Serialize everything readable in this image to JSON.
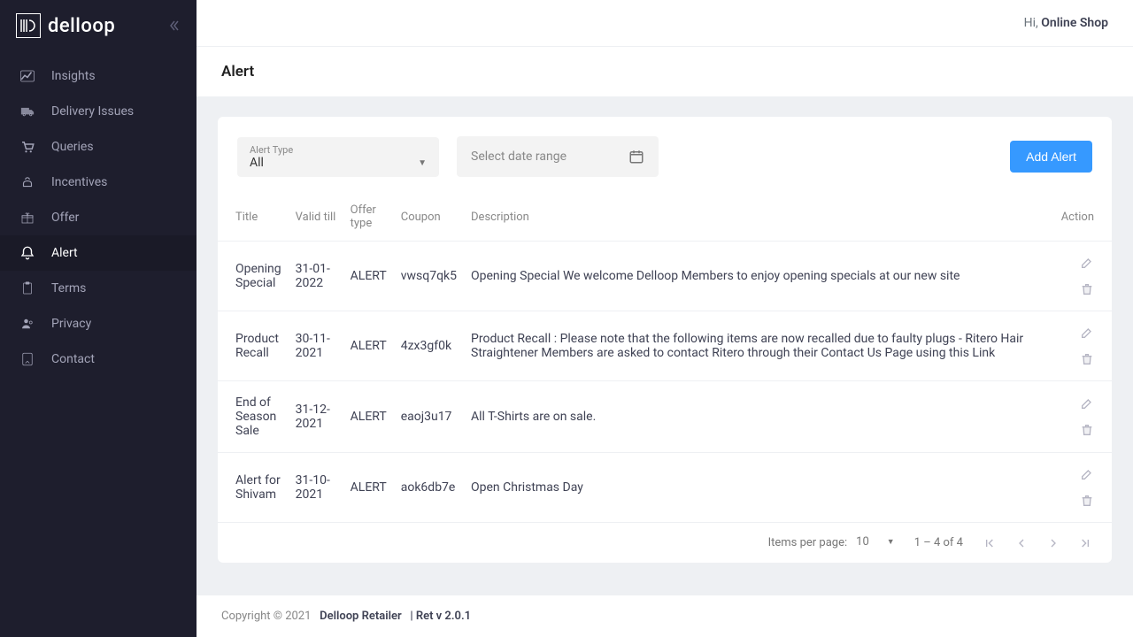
{
  "brand": "delloop",
  "greeting_prefix": "Hi, ",
  "user_name": "Online Shop",
  "page_title": "Alert",
  "sidebar": {
    "items": [
      {
        "label": "Insights",
        "icon": "chart"
      },
      {
        "label": "Delivery Issues",
        "icon": "truck"
      },
      {
        "label": "Queries",
        "icon": "cart"
      },
      {
        "label": "Incentives",
        "icon": "hand"
      },
      {
        "label": "Offer",
        "icon": "gift"
      },
      {
        "label": "Alert",
        "icon": "bell",
        "active": true
      },
      {
        "label": "Terms",
        "icon": "clipboard"
      },
      {
        "label": "Privacy",
        "icon": "user"
      },
      {
        "label": "Contact",
        "icon": "phone"
      }
    ]
  },
  "filters": {
    "alert_type_label": "Alert Type",
    "alert_type_value": "All",
    "date_placeholder": "Select date range"
  },
  "add_button": "Add Alert",
  "table": {
    "headers": {
      "title": "Title",
      "valid_till": "Valid till",
      "offer_type": "Offer type",
      "coupon": "Coupon",
      "description": "Description",
      "action": "Action"
    },
    "rows": [
      {
        "title": "Opening Special",
        "valid_till": "31-01-2022",
        "offer_type": "ALERT",
        "coupon": "vwsq7qk5",
        "description": "Opening Special We welcome Delloop Members to enjoy opening specials at our new site"
      },
      {
        "title": "Product Recall",
        "valid_till": "30-11-2021",
        "offer_type": "ALERT",
        "coupon": "4zx3gf0k",
        "description": "Product Recall : Please note that the following items are now recalled due to faulty plugs - Ritero Hair Straightener Members are asked to contact Ritero through their Contact Us Page using this Link"
      },
      {
        "title": "End of Season Sale",
        "valid_till": "31-12-2021",
        "offer_type": "ALERT",
        "coupon": "eaoj3u17",
        "description": "All T-Shirts are on sale."
      },
      {
        "title": "Alert for Shivam",
        "valid_till": "31-10-2021",
        "offer_type": "ALERT",
        "coupon": "aok6db7e",
        "description": "Open Christmas Day"
      }
    ]
  },
  "pagination": {
    "items_per_page_label": "Items per page:",
    "items_per_page_value": "10",
    "range": "1 – 4 of 4"
  },
  "footer": {
    "copyright": "Copyright © 2021",
    "app_name": "Delloop Retailer",
    "version": "| Ret v 2.0.1"
  }
}
